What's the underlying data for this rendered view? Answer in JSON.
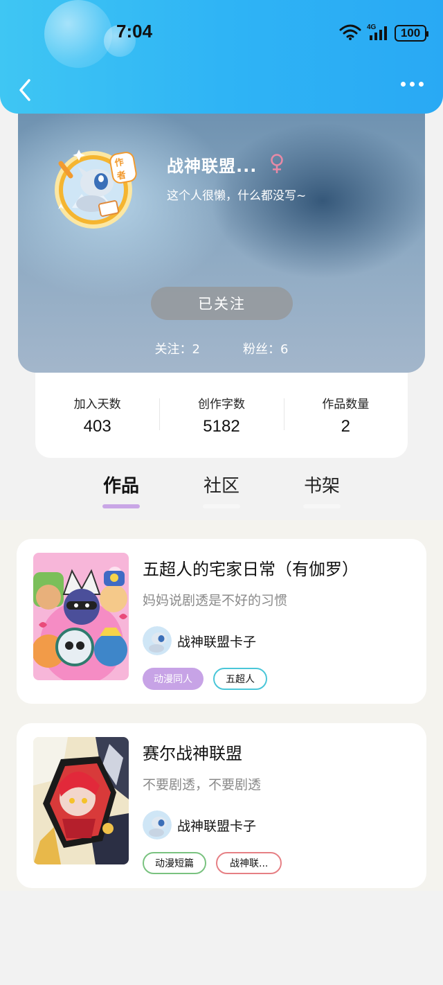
{
  "status": {
    "time": "7:04",
    "network": "4G",
    "battery": "100"
  },
  "profile": {
    "nickname": "战神联盟...",
    "gender_symbol": "♀",
    "bio": "这个人很懒，什么都没写~",
    "author_badge": "作者",
    "follow_button": "已关注",
    "following": "关注：2",
    "followers": "粉丝：6"
  },
  "stats": [
    {
      "label": "加入天数",
      "value": "403"
    },
    {
      "label": "创作字数",
      "value": "5182"
    },
    {
      "label": "作品数量",
      "value": "2"
    }
  ],
  "tabs": [
    {
      "label": "作品",
      "active": true
    },
    {
      "label": "社区",
      "active": false
    },
    {
      "label": "书架",
      "active": false
    }
  ],
  "works": [
    {
      "title": "五超人的宅家日常（有伽罗）",
      "desc": "妈妈说剧透是不好的习惯",
      "author": "战神联盟卡子",
      "tags": [
        "动漫同人",
        "五超人"
      ]
    },
    {
      "title": "赛尔战神联盟",
      "desc": "不要剧透，不要剧透",
      "author": "战神联盟卡子",
      "tags": [
        "动漫短篇",
        "战神联..."
      ]
    }
  ],
  "colors": {
    "header_blue": "#2fb4f5",
    "tab_active_underline": "#c9a6e6",
    "gender_pink": "#e98aa6",
    "tag_purple": "#c7a3e6",
    "tag_cyan": "#49c6d8",
    "tag_green": "#79c27f",
    "tag_red": "#e67f84"
  }
}
